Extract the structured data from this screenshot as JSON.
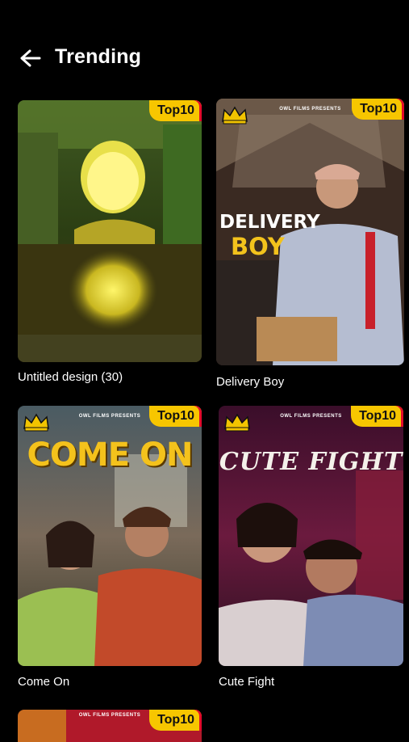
{
  "header": {
    "title": "Trending",
    "back_icon": "arrow-left-icon"
  },
  "badge_label": "Top10",
  "studio_label": "OWL FILMS PRESENTS",
  "cards": [
    {
      "caption": "Untitled design (30)"
    },
    {
      "caption": "Delivery Boy",
      "poster_line1": "DELIVERY",
      "poster_line2": "BOY"
    },
    {
      "caption": "Come On",
      "poster_title": "COME ON"
    },
    {
      "caption": "Cute Fight",
      "poster_title": "CUTE FIGHT"
    }
  ],
  "colors": {
    "background": "#000000",
    "badge": "#f7c600",
    "accent_red": "#e30b2a"
  }
}
